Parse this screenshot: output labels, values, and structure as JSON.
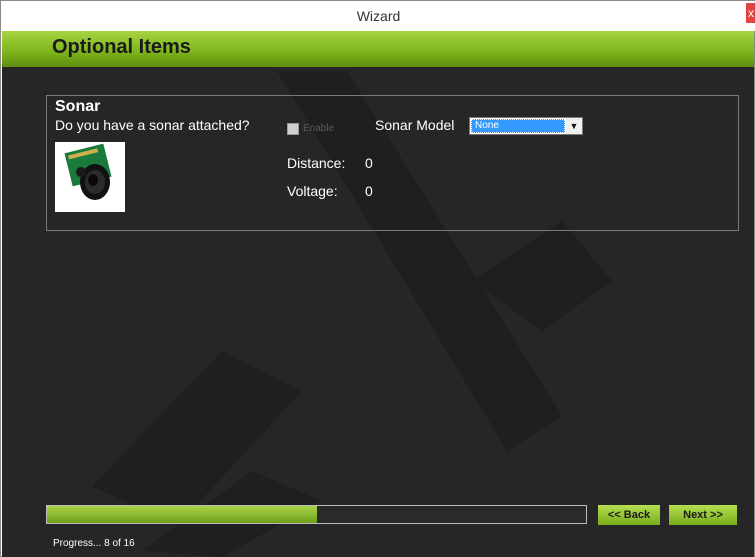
{
  "window": {
    "title": "Wizard",
    "close_glyph": "x"
  },
  "header": {
    "title": "Optional Items",
    "accent_color": "#7fb61d"
  },
  "sonar": {
    "group_title": "Sonar",
    "question": "Do you have a sonar attached?",
    "enable_label": "Enable",
    "enable_checked": false,
    "model_label": "Sonar Model",
    "model_value": "None",
    "distance_label": "Distance:",
    "distance_value": "0",
    "voltage_label": "Voltage:",
    "voltage_value": "0",
    "image_icon": "sonar-sensor-image"
  },
  "footer": {
    "back_label": "<< Back",
    "next_label": "Next >>",
    "progress_text": "Progress... 8 of 16",
    "progress_fraction": 0.5
  }
}
